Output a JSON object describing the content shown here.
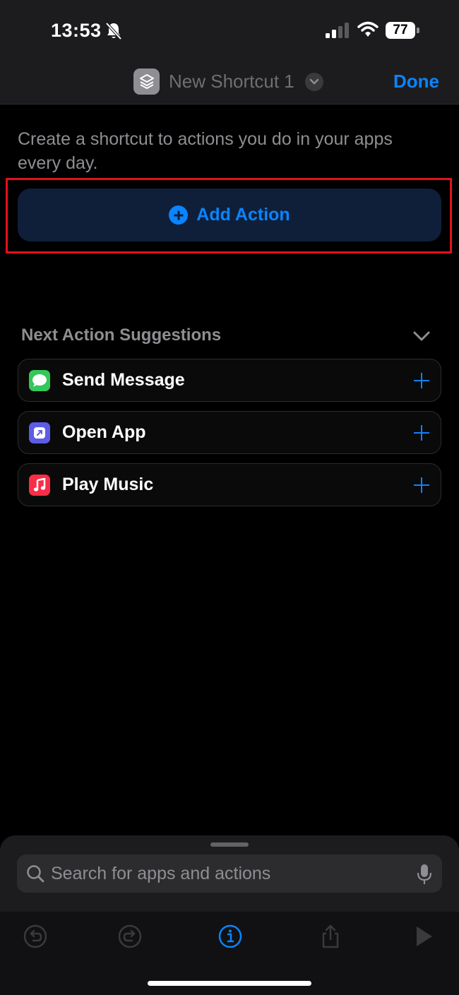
{
  "status_bar": {
    "time": "13:53",
    "battery": "77",
    "icons": [
      "bell-off-icon",
      "signal-icon",
      "wifi-icon",
      "battery-icon"
    ]
  },
  "nav": {
    "title": "New Shortcut 1",
    "done_label": "Done",
    "app_icon": "shortcuts-icon"
  },
  "main": {
    "intro": "Create a shortcut to actions you do in your apps every day.",
    "add_action_label": "Add Action"
  },
  "suggestions": {
    "header": "Next Action Suggestions",
    "items": [
      {
        "label": "Send Message",
        "icon": "messages-icon",
        "color": "#34c759"
      },
      {
        "label": "Open App",
        "icon": "open-app-icon",
        "color": "#5e5ce6"
      },
      {
        "label": "Play Music",
        "icon": "music-icon",
        "color": "#fa2d48"
      }
    ]
  },
  "search": {
    "placeholder": "Search for apps and actions"
  },
  "toolbar": {
    "items": [
      "undo-icon",
      "redo-icon",
      "info-icon",
      "share-icon",
      "play-icon"
    ]
  },
  "colors": {
    "accent": "#0a84ff",
    "highlight": "#e0121c",
    "background": "#000000"
  }
}
